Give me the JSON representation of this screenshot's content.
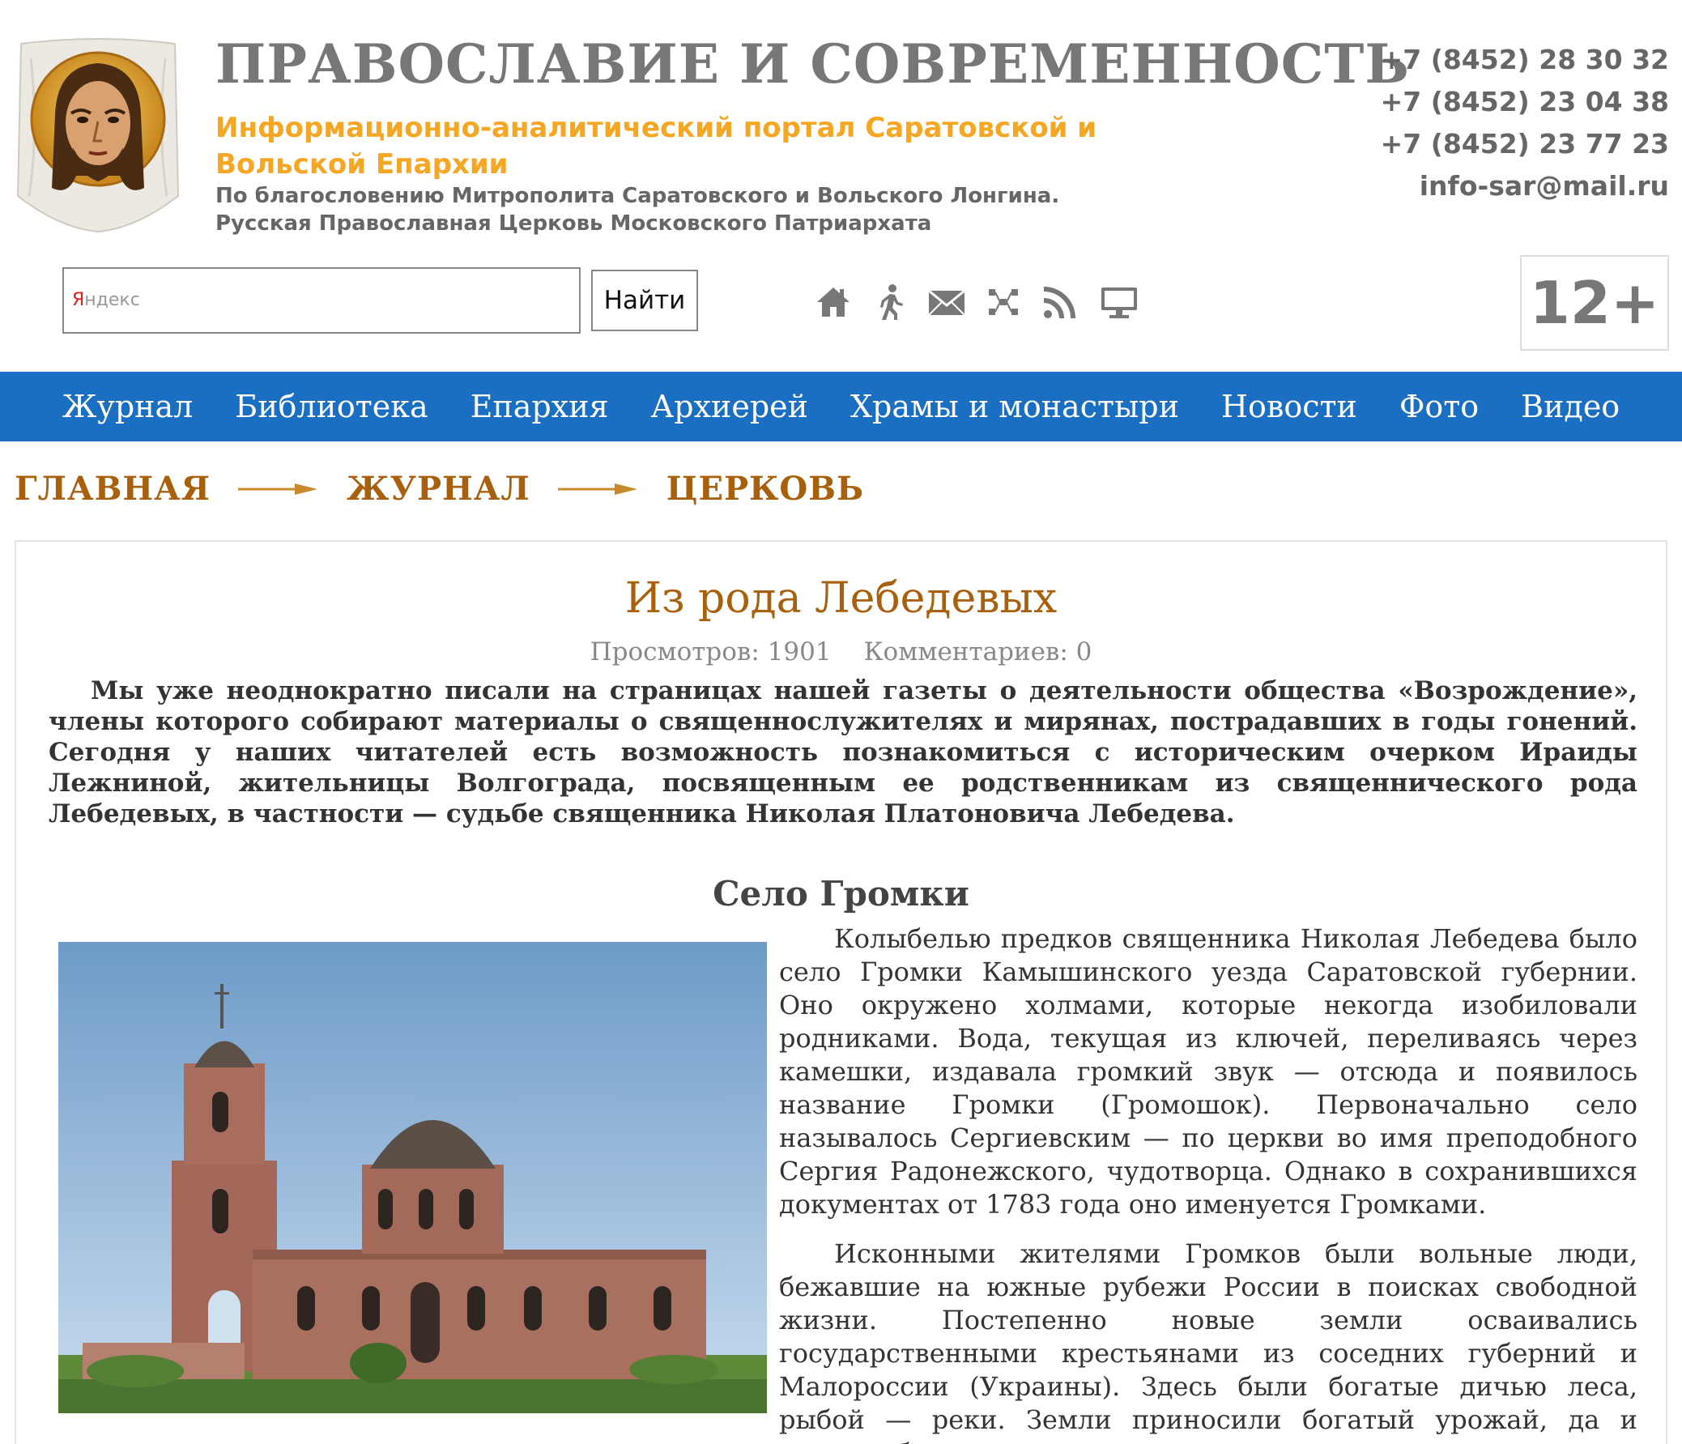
{
  "header": {
    "title": "ПРАВОСЛАВИЕ И СОВРЕМЕННОСТЬ",
    "subtitle": "Информационно-аналитический портал Саратовской и Вольской Епархии",
    "blessing_line1": "По благословению Митрополита Саратовского и Вольского Лонгина.",
    "blessing_line2": "Русская Православная Церковь Московского Патриархата",
    "phones": [
      "+7 (8452) 28 30 32",
      "+7 (8452) 23 04 38",
      "+7 (8452) 23 77 23"
    ],
    "email": "info-sar@mail.ru",
    "age_rating": "12+"
  },
  "search": {
    "provider_label_first": "Я",
    "provider_label_rest": "ндекс",
    "value": "",
    "button_label": "Найти"
  },
  "icons": [
    "home-icon",
    "walker-icon",
    "mail-icon",
    "sitemap-icon",
    "rss-icon",
    "monitor-icon"
  ],
  "nav": [
    "Журнал",
    "Библиотека",
    "Епархия",
    "Архиерей",
    "Храмы и монастыри",
    "Новости",
    "Фото",
    "Видео"
  ],
  "breadcrumb": [
    "ГЛАВНАЯ",
    "ЖУРНАЛ",
    "ЦЕРКОВЬ"
  ],
  "article": {
    "title": "Из рода Лебедевых",
    "views": "Просмотров: 1901",
    "comments": "Комментариев: 0",
    "lead": "Мы уже неоднократно писали на страницах нашей газеты о деятельности общества «Возрождение», члены которого собирают материалы о священнослужителях и мирянах, пострадавших в годы гонений. Сегодня у наших читателей есть возможность познакомиться с историческим очерком Ираиды Лежниной, жительницы Волгограда, посвященным ее родственникам из священнического рода Лебедевых, в частности — судьбе священника Николая Платоновича Лебедева.",
    "section_title": "Село Громки",
    "paragraph1": "Колыбелью предков священника Николая Лебедева было село Громки Камышинского уезда Саратовской губернии. Оно окружено холмами, которые некогда изобиловали родниками. Вода, текущая из ключей, переливаясь через камешки, издавала громкий звук — отсюда и появилось название Громки (Громошок). Первоначально село называлось Сергиевским — по церкви во имя преподобного Сергия Радонежского, чудотворца. Однако в сохранившихся документах от 1783 года оно именуется Громками.",
    "paragraph2": "Исконными жителями Громков были вольные люди, бежавшие на южные рубежи России в поисках свободной жизни. Постепенно новые земли осваивались государственными крестьянами из соседних губерний и Малороссии (Украины). Здесь были богатые дичью леса, рыбой — реки. Земли приносили богатый урожай, да и трудолюбия,"
  },
  "colors": {
    "nav_bg": "#1b6fc2",
    "subtitle": "#f5a623",
    "accent_brown": "#a8600c",
    "title_gray": "#777777"
  }
}
